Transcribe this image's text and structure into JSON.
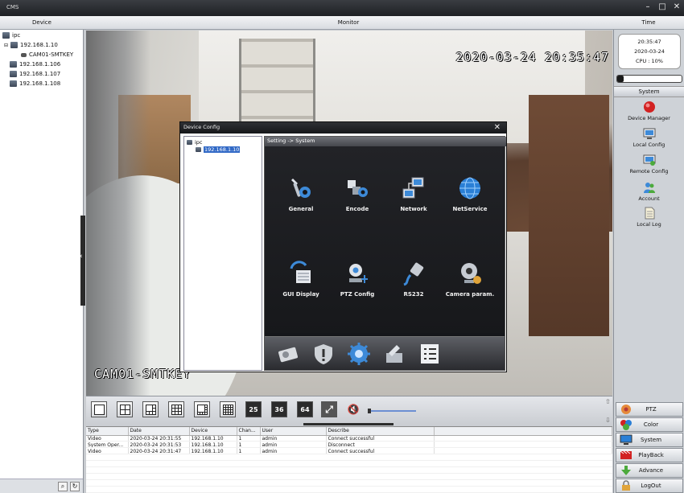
{
  "window": {
    "title": "CMS"
  },
  "columns": {
    "device": "Device",
    "monitor": "Monitor",
    "time": "Time"
  },
  "device_tree": {
    "root": "ipc",
    "devices": [
      "192.168.1.10",
      "CAM01-SMTKEY",
      "192.168.1.106",
      "192.168.1.107",
      "192.168.1.108"
    ]
  },
  "video": {
    "osd_datetime": "2020-03-24 20:35:47",
    "osd_name": "CAM01-SMTKEY"
  },
  "dialog": {
    "title": "Device Config",
    "tree_root": "ipc",
    "tree_selected": "192.168.1.10",
    "breadcrumb": "Setting -> System",
    "items": [
      {
        "label": "General",
        "icon": "tools-gear-icon"
      },
      {
        "label": "Encode",
        "icon": "encode-icon"
      },
      {
        "label": "Network",
        "icon": "network-icon"
      },
      {
        "label": "NetService",
        "icon": "globe-icon"
      },
      {
        "label": "GUI Display",
        "icon": "gui-display-icon"
      },
      {
        "label": "PTZ Config",
        "icon": "ptz-camera-icon"
      },
      {
        "label": "RS232",
        "icon": "serial-cable-icon"
      },
      {
        "label": "Camera param.",
        "icon": "webcam-icon"
      }
    ],
    "bottom_tabs": [
      "storage-icon",
      "alarm-shield-icon",
      "system-gear-icon",
      "tools-icon",
      "info-list-icon"
    ]
  },
  "toolbar": {
    "layouts": [
      "1",
      "4",
      "6",
      "9",
      "8",
      "16",
      "25",
      "36",
      "64"
    ]
  },
  "log": {
    "headers": [
      "Type",
      "Date",
      "Device",
      "Chan...",
      "User",
      "Describe"
    ],
    "rows": [
      [
        "Video",
        "2020-03-24 20:31:55",
        "192.168.1.10",
        "1",
        "admin",
        "Connect successful"
      ],
      [
        "System Oper...",
        "2020-03-24 20:31:53",
        "192.168.1.10",
        "1",
        "admin",
        "Disconnect"
      ],
      [
        "Video",
        "2020-03-24 20:31:47",
        "192.168.1.10",
        "1",
        "admin",
        "Connect successful"
      ]
    ]
  },
  "right_panel": {
    "time": "20:35:47",
    "date": "2020-03-24",
    "cpu": "CPU : 10%",
    "cpu_fraction": 0.1,
    "section": "System",
    "items": [
      "Device Manager",
      "Local Config",
      "Remote Config",
      "Account",
      "Local Log"
    ],
    "buttons": [
      "PTZ",
      "Color",
      "System",
      "PlayBack",
      "Advance",
      "LogOut"
    ]
  },
  "colors": {
    "selection": "#3169c6",
    "accent_red": "#d22222"
  }
}
